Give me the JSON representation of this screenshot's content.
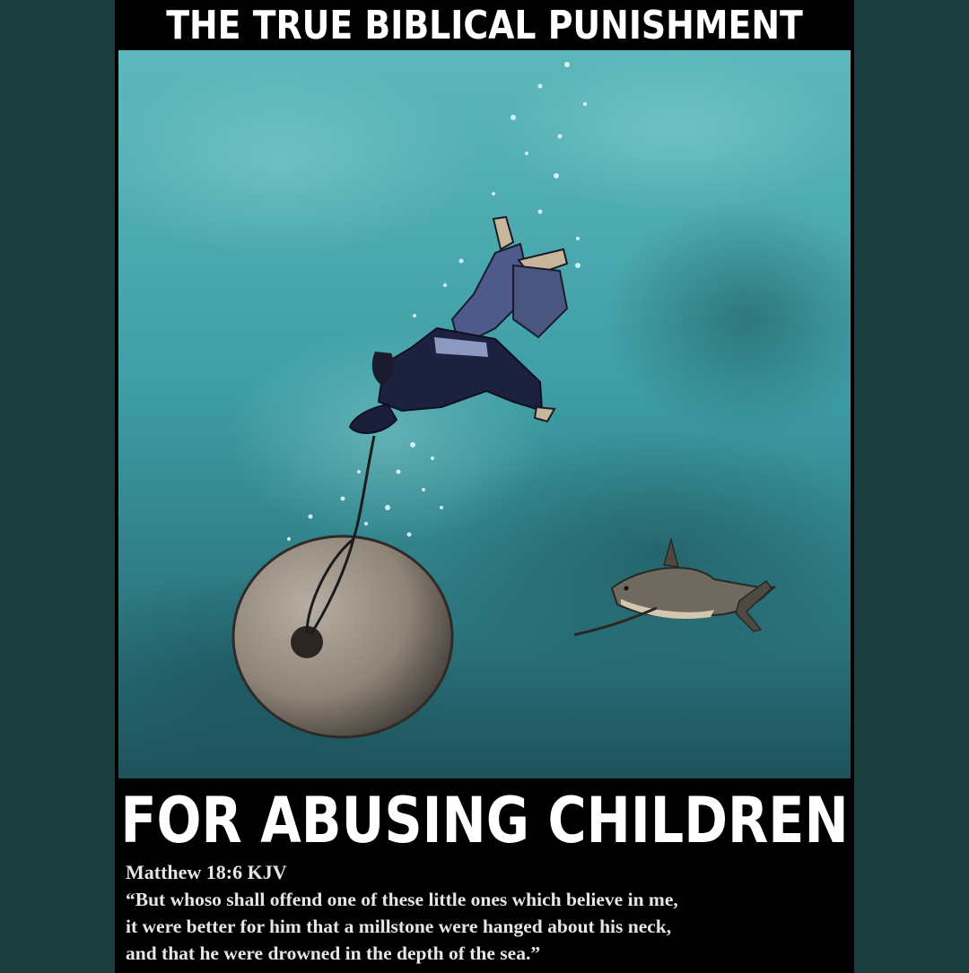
{
  "poster": {
    "top_title": "THE TRUE BIBLICAL PUNISHMENT",
    "bottom_title": "FOR ABUSING CHILDREN",
    "reference": "Matthew 18:6 KJV",
    "verse_lines": [
      "“But whoso shall offend one of these little ones which believe in me,",
      "it were better for him that a millstone were hanged about his neck,",
      "and that he were drowned in the depth of the sea.”"
    ]
  },
  "colors": {
    "background": "#1b3d3d",
    "poster_bg": "#000000",
    "water_light": "#4fb0b4",
    "water_dark": "#1f5a63",
    "text": "#ffffff"
  },
  "illustration": {
    "subjects": [
      "sinking-man",
      "millstone",
      "rope",
      "shark",
      "bubbles"
    ]
  }
}
